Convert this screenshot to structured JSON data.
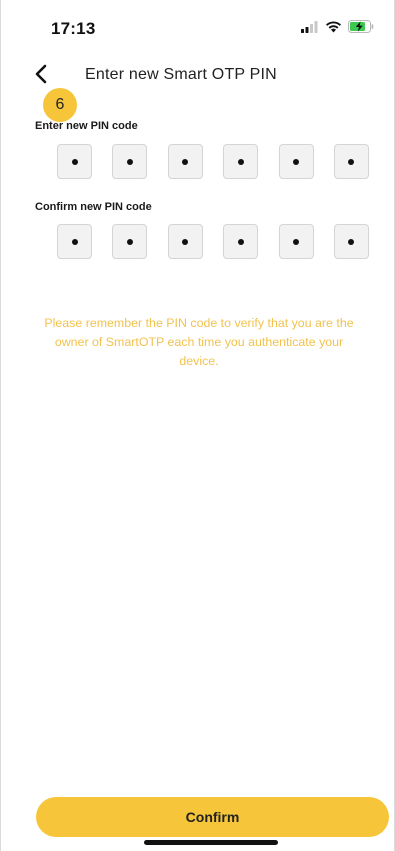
{
  "status_bar": {
    "time": "17:13",
    "icons": [
      "signal-icon",
      "wifi-icon",
      "battery-charging-icon"
    ]
  },
  "header": {
    "back_icon": "chevron-left-icon",
    "title": "Enter new Smart OTP PIN"
  },
  "step_badge": "6",
  "new_pin": {
    "label": "Enter new PIN code",
    "filled_digits": 6,
    "total_digits": 6
  },
  "confirm_pin": {
    "label": "Confirm new PIN code",
    "filled_digits": 6,
    "total_digits": 6
  },
  "notice": "Please remember the PIN code to verify that you are the owner of SmartOTP each time you authenticate your device.",
  "confirm_button": {
    "label": "Confirm"
  },
  "colors": {
    "accent": "#f6c53a",
    "notice_text": "#f2c24e",
    "pin_box_bg": "#f2f2f2",
    "pin_box_border": "#d4d4d4"
  }
}
